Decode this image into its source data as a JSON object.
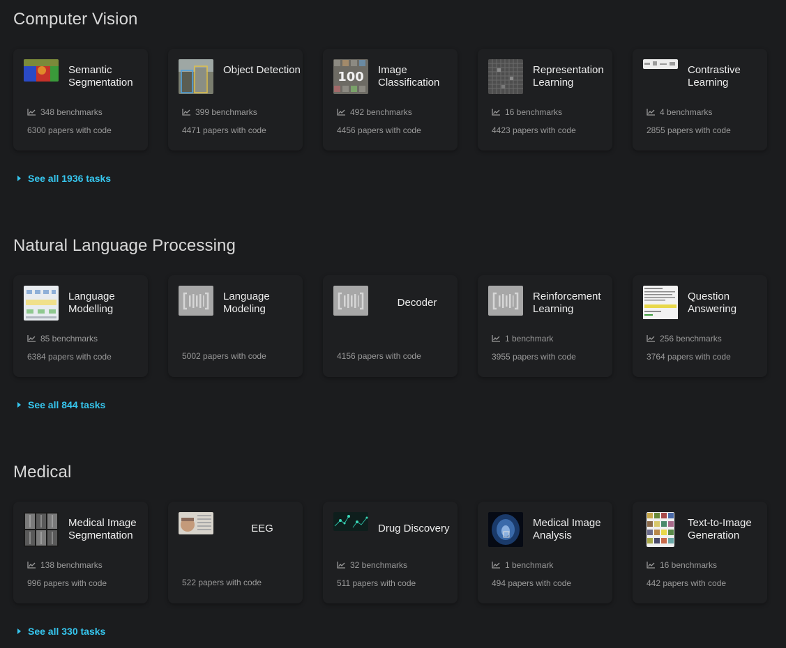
{
  "sections": [
    {
      "title": "Computer Vision",
      "see_all": "See all 1936 tasks",
      "cards": [
        {
          "name": "Semantic Segmentation",
          "benchmarks": "348 benchmarks",
          "papers": "6300 papers with code",
          "thumb": "segmentation"
        },
        {
          "name": "Object Detection",
          "benchmarks": "399 benchmarks",
          "papers": "4471 papers with code",
          "thumb": "detection"
        },
        {
          "name": "Image Classification",
          "benchmarks": "492 benchmarks",
          "papers": "4456 papers with code",
          "thumb": "classification"
        },
        {
          "name": "Representation Learning",
          "benchmarks": "16 benchmarks",
          "papers": "4423 papers with code",
          "thumb": "representation"
        },
        {
          "name": "Contrastive Learning",
          "benchmarks": "4 benchmarks",
          "papers": "2855 papers with code",
          "thumb": "contrastive"
        }
      ]
    },
    {
      "title": "Natural Language Processing",
      "see_all": "See all 844 tasks",
      "cards": [
        {
          "name": "Language Modelling",
          "benchmarks": "85 benchmarks",
          "papers": "6384 papers with code",
          "thumb": "lm-diagram"
        },
        {
          "name": "Language Modeling",
          "benchmarks": "",
          "papers": "5002 papers with code",
          "thumb": "placeholder"
        },
        {
          "name": "Decoder",
          "benchmarks": "",
          "papers": "4156 papers with code",
          "thumb": "placeholder"
        },
        {
          "name": "Reinforcement Learning",
          "benchmarks": "1 benchmark",
          "papers": "3955 papers with code",
          "thumb": "placeholder"
        },
        {
          "name": "Question Answering",
          "benchmarks": "256 benchmarks",
          "papers": "3764 papers with code",
          "thumb": "qa"
        }
      ]
    },
    {
      "title": "Medical",
      "see_all": "See all 330 tasks",
      "cards": [
        {
          "name": "Medical Image Segmentation",
          "benchmarks": "138 benchmarks",
          "papers": "996 papers with code",
          "thumb": "med-seg"
        },
        {
          "name": "EEG",
          "benchmarks": "",
          "papers": "522 papers with code",
          "thumb": "eeg"
        },
        {
          "name": "Drug Discovery",
          "benchmarks": "32 benchmarks",
          "papers": "511 papers with code",
          "thumb": "drug"
        },
        {
          "name": "Medical Image Analysis",
          "benchmarks": "1 benchmark",
          "papers": "494 papers with code",
          "thumb": "brain"
        },
        {
          "name": "Text-to-Image Generation",
          "benchmarks": "16 benchmarks",
          "papers": "442 papers with code",
          "thumb": "t2i"
        }
      ]
    }
  ],
  "colors": {
    "background": "#1b1c1e",
    "card": "#1e1f21",
    "link": "#36c6ee",
    "muted": "#9a9a9a"
  }
}
